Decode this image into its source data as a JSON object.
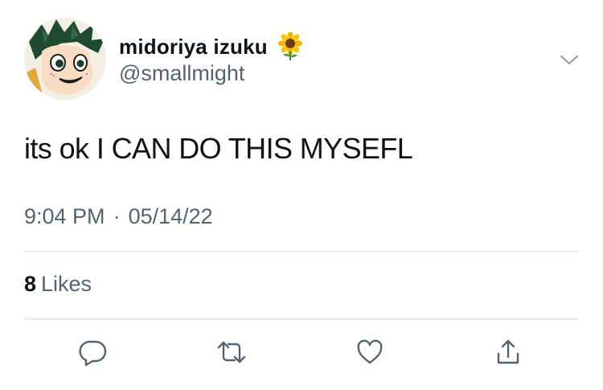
{
  "tweet": {
    "author": {
      "display_name": "midoriya izuku",
      "name_emoji": "sunflower",
      "handle": "@smallmight"
    },
    "text": "its ok I CAN DO THIS MYSEFL",
    "time": "9:04 PM",
    "separator": "·",
    "date": "05/14/22",
    "likes": {
      "count": "8",
      "label": "Likes"
    }
  },
  "icons": {
    "menu": "chevron-down-icon",
    "reply": "reply-icon",
    "retweet": "retweet-icon",
    "like": "heart-icon",
    "share": "share-icon"
  },
  "colors": {
    "text_primary": "#0f1419",
    "text_secondary": "#536471",
    "divider": "#d9dee2",
    "avatar_hair": "#1f4a32"
  }
}
